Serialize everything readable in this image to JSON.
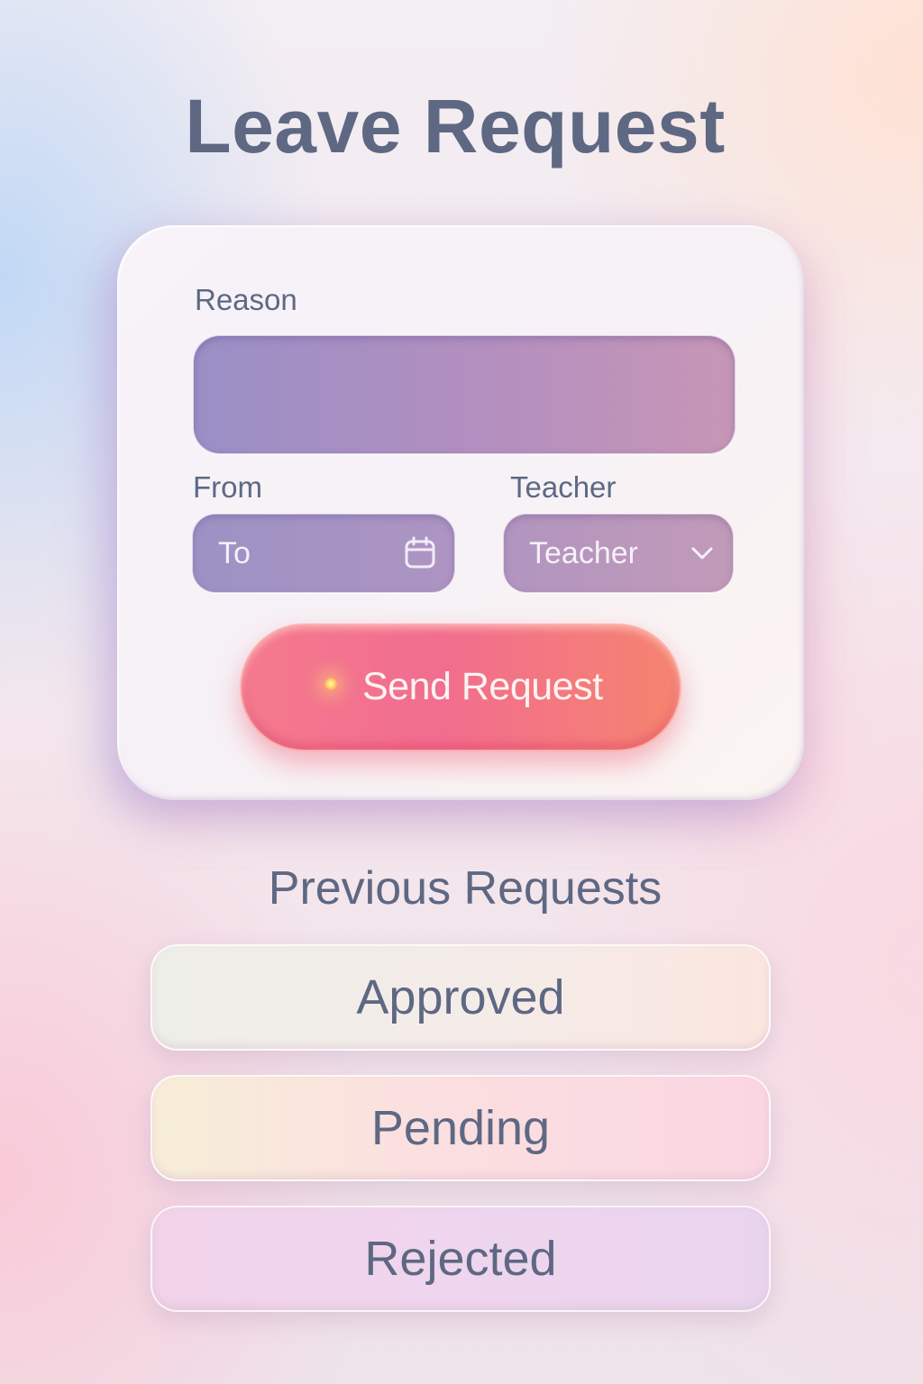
{
  "header": {
    "title": "Leave Request"
  },
  "form": {
    "reason_label": "Reason",
    "reason_value": "",
    "from_label": "From",
    "date_value": "To",
    "teacher_label": "Teacher",
    "teacher_selected": "Teacher",
    "submit_label": "Send Request",
    "icons": {
      "date": "calendar-icon",
      "teacher": "chevron-down-icon"
    }
  },
  "history": {
    "title": "Previous Requests",
    "items": [
      {
        "label": "Approved"
      },
      {
        "label": "Pending"
      },
      {
        "label": "Rejected"
      }
    ]
  },
  "colors": {
    "text": "#5e6883",
    "accent_button": "#f26d8f",
    "field": "#a590c4"
  }
}
